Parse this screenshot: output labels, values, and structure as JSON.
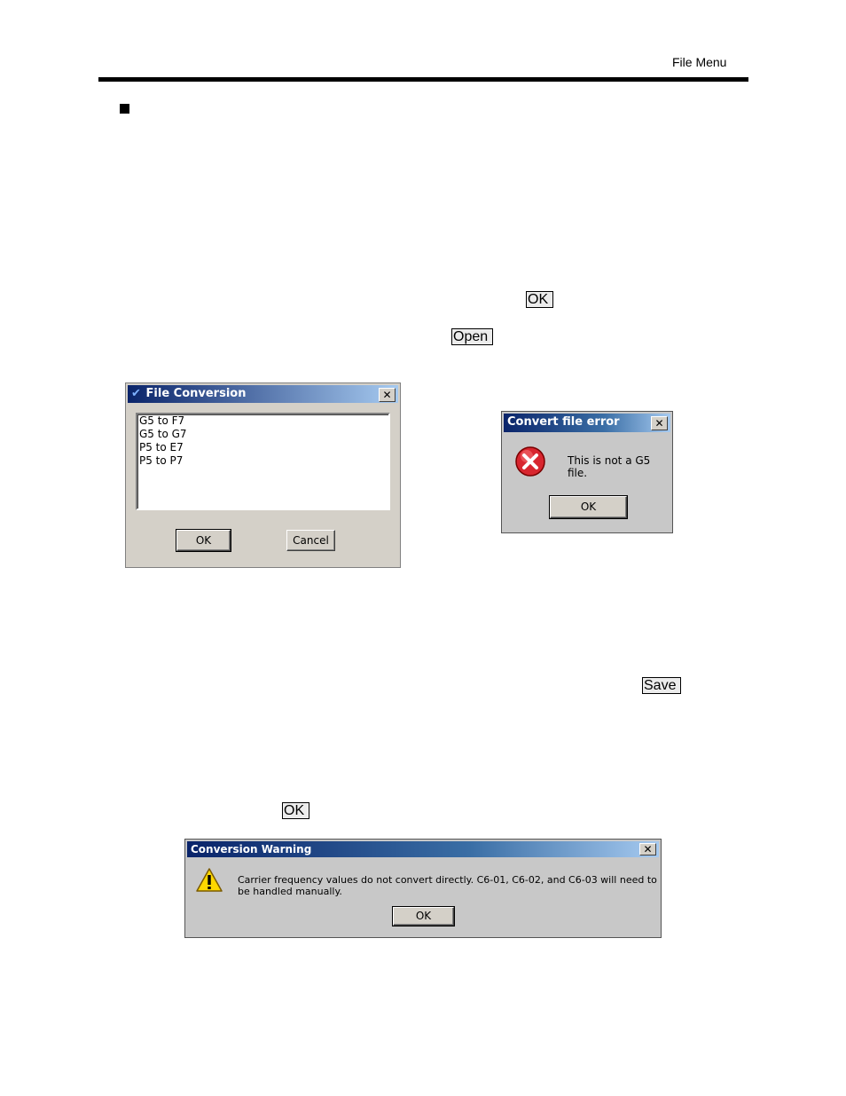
{
  "header": {
    "section": "File Menu"
  },
  "inline_buttons": {
    "ok_1": "OK",
    "open": "Open",
    "save": "Save",
    "ok_2": "OK"
  },
  "file_conversion_dialog": {
    "title": "File Conversion",
    "close": "✕",
    "options": [
      "G5 to F7",
      "G5 to G7",
      "P5 to E7",
      "P5 to P7"
    ],
    "ok": "OK",
    "cancel": "Cancel"
  },
  "convert_error_dialog": {
    "title": "Convert file error",
    "close": "✕",
    "message": "This is not a G5 file.",
    "ok": "OK",
    "icon": "error-icon"
  },
  "conversion_warning_dialog": {
    "title": "Conversion Warning",
    "close": "✕",
    "message": "Carrier frequency values do not convert directly. C6-01, C6-02, and C6-03 will need to be handled manually.",
    "ok": "OK",
    "icon": "warning-icon"
  }
}
